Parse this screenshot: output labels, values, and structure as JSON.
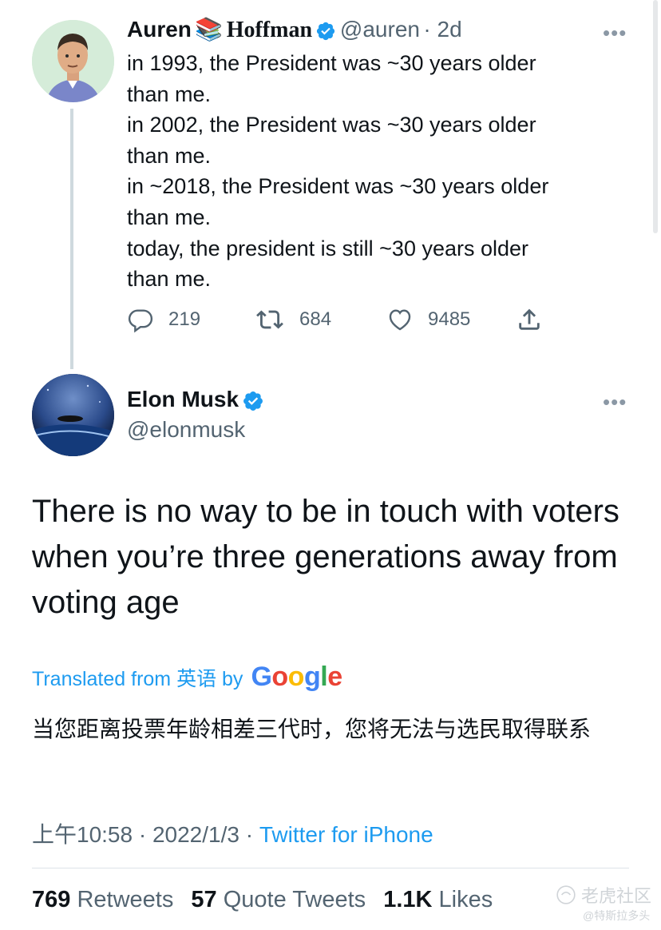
{
  "quoted_tweet": {
    "name_first": "Auren",
    "name_emoji": "📚",
    "name_last": "Hoffman",
    "handle": "@auren",
    "time": "· 2d",
    "lines": [
      "in 1993, the President was ~30 years older",
      "than me.",
      "in 2002, the President was ~30 years older",
      "than me.",
      "in ~2018, the President was ~30 years older",
      "than me.",
      "today, the president is still ~30 years older",
      "than me."
    ],
    "replies": "219",
    "retweets": "684",
    "likes": "9485",
    "more": "•••"
  },
  "main_tweet": {
    "name": "Elon Musk",
    "handle": "@elonmusk",
    "more": "•••",
    "text": "There is no way to be in touch with voters when you’re three generations away from voting age",
    "translated_prefix": "Translated from 英语 by",
    "google_letters": [
      "G",
      "o",
      "o",
      "g",
      "l",
      "e"
    ],
    "translation": "当您距离投票年龄相差三代时，您将无法与选民取得联系",
    "time": "上午10:58 · 2022/1/3 · ",
    "source": "Twitter for iPhone",
    "stats": {
      "retweets_count": "769",
      "retweets_label": "Retweets",
      "quotes_count": "57",
      "quotes_label": "Quote Tweets",
      "likes_count": "1.1K",
      "likes_label": "Likes"
    }
  },
  "watermark": {
    "text": "老虎社区",
    "sub": "@特斯拉多头"
  },
  "colors": {
    "verified": "#1d9bf0",
    "link": "#1d9bf0",
    "muted": "#536471",
    "google": [
      "#4285F4",
      "#EA4335",
      "#FBBC05",
      "#4285F4",
      "#34A853",
      "#EA4335"
    ]
  }
}
